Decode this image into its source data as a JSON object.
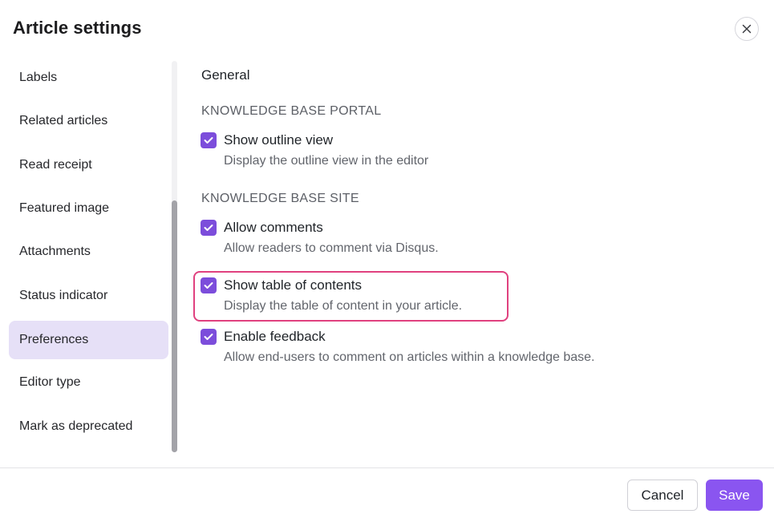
{
  "dialog": {
    "title": "Article settings",
    "close_icon": "close-icon"
  },
  "sidebar": {
    "items": [
      {
        "label": "Labels"
      },
      {
        "label": "Related articles"
      },
      {
        "label": "Read receipt"
      },
      {
        "label": "Featured image"
      },
      {
        "label": "Attachments"
      },
      {
        "label": "Status indicator"
      },
      {
        "label": "Preferences",
        "active": true
      },
      {
        "label": "Editor type"
      },
      {
        "label": "Mark as deprecated"
      }
    ]
  },
  "main": {
    "section_title": "General",
    "groups": [
      {
        "heading": "KNOWLEDGE BASE PORTAL",
        "options": [
          {
            "label": "Show outline view",
            "description": "Display the outline view in the editor",
            "checked": true
          }
        ]
      },
      {
        "heading": "KNOWLEDGE BASE SITE",
        "options": [
          {
            "label": "Allow comments",
            "description": "Allow readers to comment via Disqus.",
            "checked": true
          },
          {
            "label": "Show table of contents",
            "description": "Display the table of content in your article.",
            "checked": true,
            "highlighted": true
          },
          {
            "label": "Enable feedback",
            "description": "Allow end-users to comment on articles within a knowledge base.",
            "checked": true
          }
        ]
      }
    ]
  },
  "footer": {
    "cancel_label": "Cancel",
    "save_label": "Save"
  },
  "colors": {
    "accent": "#8a55f0",
    "checkbox": "#7c4ddb",
    "active_nav_bg": "#e6e0f7",
    "highlight_border": "#e0417f"
  }
}
